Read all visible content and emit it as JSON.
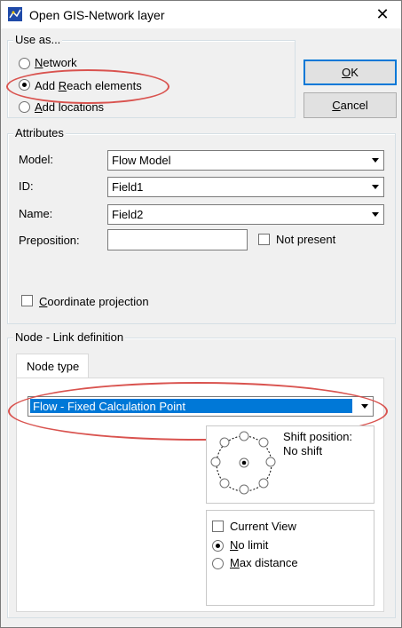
{
  "window": {
    "title": "Open GIS-Network layer",
    "close_glyph": "✕"
  },
  "use_as": {
    "legend": "Use as...",
    "options": [
      {
        "pre": "",
        "key": "N",
        "post": "etwork",
        "selected": false
      },
      {
        "pre": "Add ",
        "key": "R",
        "post": "each elements",
        "selected": true
      },
      {
        "pre": "",
        "key": "A",
        "post": "dd locations",
        "selected": false
      }
    ]
  },
  "buttons": {
    "ok": {
      "key": "O",
      "post": "K"
    },
    "cancel": {
      "key": "C",
      "post": "ancel"
    }
  },
  "attributes": {
    "legend": "Attributes",
    "model_label": "Model:",
    "model_value": "Flow Model",
    "id_label": "ID:",
    "id_value": "Field1",
    "name_label": "Name:",
    "name_value": "Field2",
    "preposition_label": "Preposition:",
    "preposition_value": "",
    "not_present_label": "Not present",
    "coord_pre": "",
    "coord_key": "C",
    "coord_post": "oordinate projection"
  },
  "node_link": {
    "legend": "Node - Link definition",
    "tab_label": "Node type",
    "node_type_value": "Flow - Fixed Calculation Point",
    "shift_label": "Shift position:",
    "shift_value": "No shift",
    "current_view_label": "Current View",
    "no_limit": {
      "key": "N",
      "post": "o limit"
    },
    "max_distance": {
      "key": "M",
      "post": "ax distance"
    }
  },
  "colors": {
    "highlight": "#0078d7",
    "annotation": "#d9534f"
  },
  "icons": {
    "app": "network-layer-icon",
    "close": "close-icon",
    "dropdown": "chevron-down-icon"
  }
}
